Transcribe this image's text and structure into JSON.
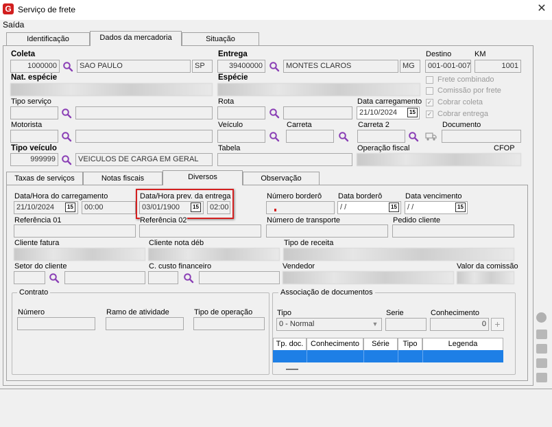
{
  "window": {
    "title": "Serviço de frete",
    "close_glyph": "✕",
    "app_icon_letter": "G"
  },
  "menu": {
    "saida": "Saída"
  },
  "main_tabs": [
    "Identificação",
    "Dados da mercadoria",
    "Situação"
  ],
  "coleta": {
    "label": "Coleta",
    "code": "1000000",
    "city": "SAO PAULO",
    "uf": "SP"
  },
  "entrega": {
    "label": "Entrega",
    "code": "39400000",
    "city": "MONTES CLAROS",
    "uf": "MG"
  },
  "destino": {
    "label": "Destino",
    "value": "001-001-007"
  },
  "km": {
    "label": "KM",
    "value": "1001"
  },
  "nat_especie": {
    "label": "Nat. espécie"
  },
  "especie": {
    "label": "Espécie"
  },
  "checkboxes": [
    {
      "label": "Frete combinado",
      "checked": false
    },
    {
      "label": "Comissão por frete",
      "checked": false
    },
    {
      "label": "Cobrar coleta",
      "checked": true
    },
    {
      "label": "Cobrar entrega",
      "checked": true
    }
  ],
  "tipo_servico": {
    "label": "Tipo serviço"
  },
  "rota": {
    "label": "Rota"
  },
  "data_carregamento_top": {
    "label": "Data carregamento",
    "value": "21/10/2024"
  },
  "motorista": {
    "label": "Motorista"
  },
  "veiculo": {
    "label": "Veículo"
  },
  "carreta": {
    "label": "Carreta"
  },
  "carreta2": {
    "label": "Carreta 2"
  },
  "documento": {
    "label": "Documento"
  },
  "tipo_veiculo": {
    "label": "Tipo veículo",
    "code": "999999",
    "desc": "VEICULOS DE CARGA EM GERAL"
  },
  "tabela": {
    "label": "Tabela"
  },
  "operacao_fiscal": {
    "label": "Operação fiscal"
  },
  "cfop": {
    "label": "CFOP"
  },
  "sub_tabs": [
    "Taxas de serviços",
    "Notas fiscais",
    "Diversos",
    "Observação"
  ],
  "diversos": {
    "data_hora_carregamento": {
      "label": "Data/Hora do carregamento",
      "date": "21/10/2024",
      "time": "00:00"
    },
    "data_hora_prev_entrega": {
      "label": "Data/Hora prev. da entrega",
      "date": "03/01/1900",
      "time": "02:00"
    },
    "numero_bordero": {
      "label": "Número borderô"
    },
    "data_bordero": {
      "label": "Data borderô",
      "value": " /  /"
    },
    "data_vencimento": {
      "label": "Data vencimento",
      "value": " /  /"
    },
    "referencia01": {
      "label": "Referência 01"
    },
    "referencia02": {
      "label": "Referência 02"
    },
    "numero_transporte": {
      "label": "Número de transporte"
    },
    "pedido_cliente": {
      "label": "Pedido cliente"
    },
    "cliente_fatura": {
      "label": "Cliente fatura"
    },
    "cliente_nota_deb": {
      "label": "Cliente nota déb"
    },
    "tipo_receita": {
      "label": "Tipo de receita"
    },
    "setor_cliente": {
      "label": "Setor do cliente"
    },
    "c_custo_financeiro": {
      "label": "C. custo financeiro"
    },
    "vendedor": {
      "label": "Vendedor"
    },
    "valor_comissao": {
      "label": "Valor da comissão"
    }
  },
  "contrato": {
    "title": "Contrato",
    "numero": "Número",
    "ramo_atividade": "Ramo de atividade",
    "tipo_operacao": "Tipo de operação"
  },
  "associacao": {
    "title": "Associação de documentos",
    "tipo_label": "Tipo",
    "tipo_value": "0 - Normal",
    "serie_label": "Serie",
    "conhecimento_label": "Conhecimento",
    "conhecimento_value": "0",
    "add_glyph": "+",
    "grid_columns": [
      "Tp. doc.",
      "Conhecimento",
      "Série",
      "Tipo",
      "Legenda"
    ]
  },
  "calendar_glyph": "15",
  "colors": {
    "highlight": "#d42020",
    "selection": "#1e7fe6",
    "lookup": "#8a3fb5"
  }
}
